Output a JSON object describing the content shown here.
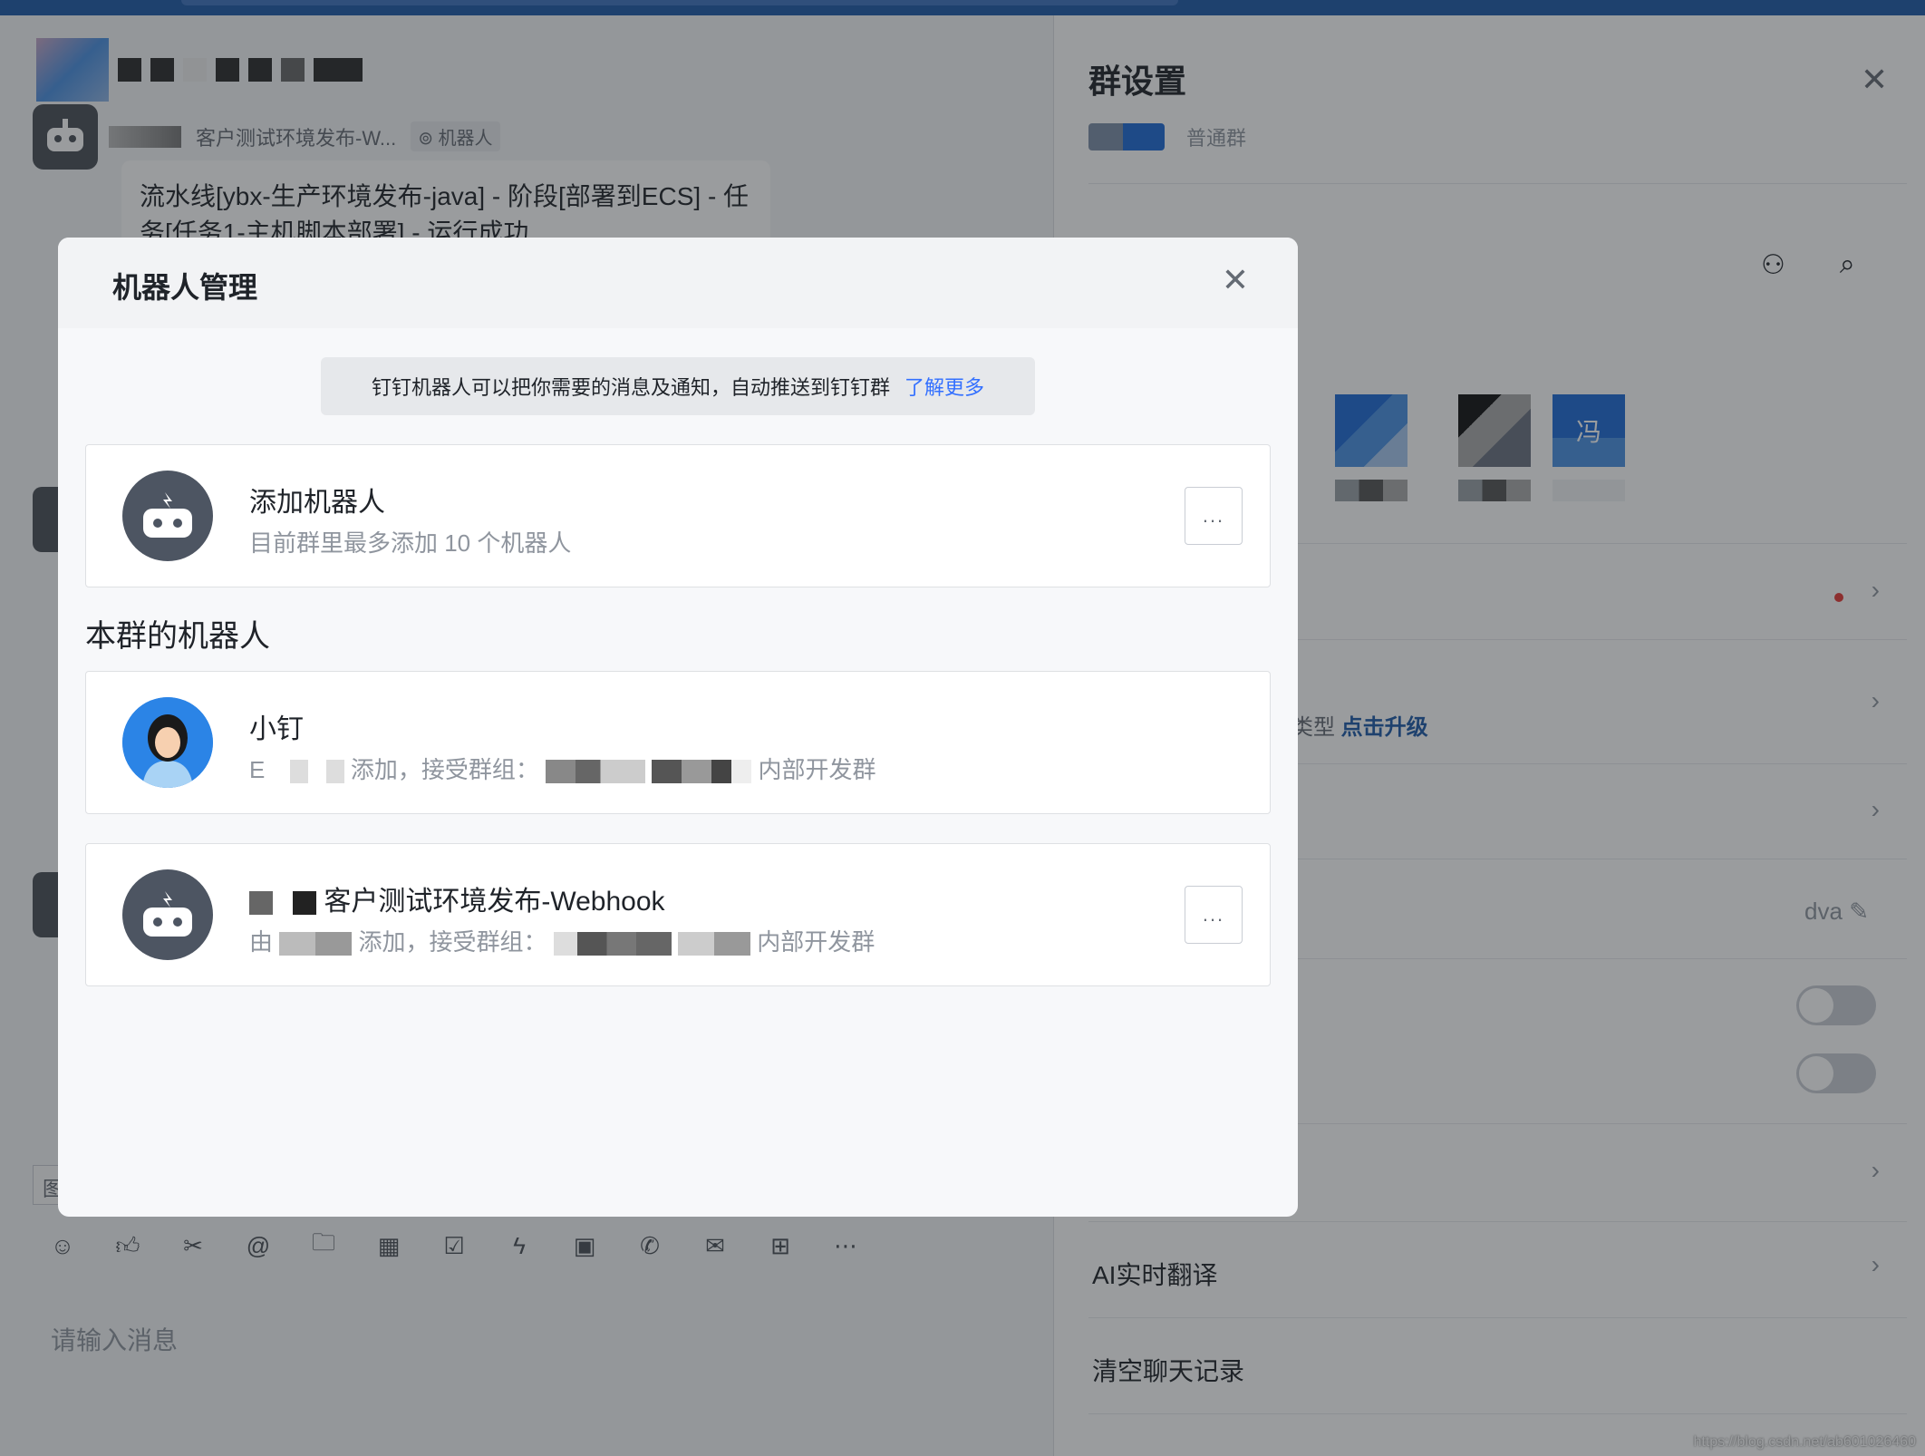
{
  "chat": {
    "sender_name": "客户测试环境发布-W...",
    "robot_tag": "机器人",
    "message_text": "流水线[ybx-生产环境发布-java] - 阶段[部署到ECS] - 任务[任务1-主机脚本部署] - 运行成功",
    "input_placeholder": "请输入消息",
    "input_chip": "图"
  },
  "settings_panel": {
    "title": "群设置",
    "group_type": "普通群",
    "upgrade_prefix": "类型",
    "upgrade_link": "点击升级",
    "name_value": "dva",
    "translate_label": "AI实时翻译",
    "clear_history_label": "清空聊天记录",
    "member_initial": "冯"
  },
  "modal": {
    "title": "机器人管理",
    "notice_text": "钉钉机器人可以把你需要的消息及通知，自动推送到钉钉群",
    "notice_link": "了解更多",
    "add_robot": {
      "title": "添加机器人",
      "subtitle": "目前群里最多添加 10 个机器人",
      "more": "..."
    },
    "section_title": "本群的机器人",
    "robots": [
      {
        "name": "小钉",
        "desc_prefix": "E",
        "desc_mid": "添加，接受群组：",
        "desc_suffix": "内部开发群"
      },
      {
        "name": "客户测试环境发布-Webhook",
        "desc_prefix": "由",
        "desc_mid": "添加，接受群组：",
        "desc_suffix": "内部开发群",
        "more": "..."
      }
    ]
  },
  "watermark": "https://blog.csdn.net/ab601026460",
  "colors": {
    "accent": "#3370ff",
    "brand_dark": "#1e5aa8",
    "toggle_off": "#c9cdd4",
    "status_dot": "#e53935"
  }
}
